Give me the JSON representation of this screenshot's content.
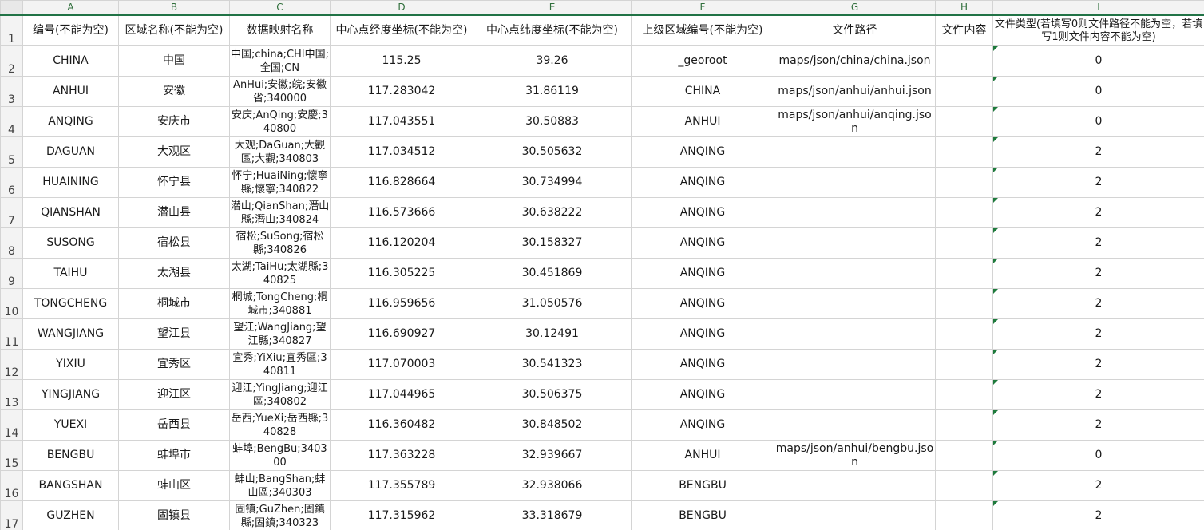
{
  "columns": [
    "A",
    "B",
    "C",
    "D",
    "E",
    "F",
    "G",
    "H",
    "I"
  ],
  "header_row": {
    "row_number": "1",
    "cells": [
      "编号(不能为空)",
      "区域名称(不能为空)",
      "数据映射名称",
      "中心点经度坐标(不能为空)",
      "中心点纬度坐标(不能为空)",
      "上级区域编号(不能为空)",
      "文件路径",
      "文件内容",
      "文件类型(若填写0则文件路径不能为空，若填写1则文件内容不能为空)"
    ]
  },
  "rows": [
    {
      "n": "2",
      "cells": [
        "CHINA",
        "中国",
        "中国;china;CHI中国;全国;CN",
        "115.25",
        "39.26",
        "_georoot",
        "maps/json/china/china.json",
        "",
        "0"
      ]
    },
    {
      "n": "3",
      "cells": [
        "ANHUI",
        "安徽",
        "AnHui;安徽;皖;安徽省;340000",
        "117.283042",
        "31.86119",
        "CHINA",
        "maps/json/anhui/anhui.json",
        "",
        "0"
      ]
    },
    {
      "n": "4",
      "cells": [
        "ANQING",
        "安庆市",
        "安庆;AnQing;安慶;340800",
        "117.043551",
        "30.50883",
        "ANHUI",
        "maps/json/anhui/anqing.json",
        "",
        "0"
      ]
    },
    {
      "n": "5",
      "cells": [
        "DAGUAN",
        "大观区",
        "大观;DaGuan;大觀區;大觀;340803",
        "117.034512",
        "30.505632",
        "ANQING",
        "",
        "",
        "2"
      ]
    },
    {
      "n": "6",
      "cells": [
        "HUAINING",
        "怀宁县",
        "怀宁;HuaiNing;懷寧縣;懷寧;340822",
        "116.828664",
        "30.734994",
        "ANQING",
        "",
        "",
        "2"
      ]
    },
    {
      "n": "7",
      "cells": [
        "QIANSHAN",
        "潜山县",
        "潜山;QianShan;潛山縣;潛山;340824",
        "116.573666",
        "30.638222",
        "ANQING",
        "",
        "",
        "2"
      ]
    },
    {
      "n": "8",
      "cells": [
        "SUSONG",
        "宿松县",
        "宿松;SuSong;宿松縣;340826",
        "116.120204",
        "30.158327",
        "ANQING",
        "",
        "",
        "2"
      ]
    },
    {
      "n": "9",
      "cells": [
        "TAIHU",
        "太湖县",
        "太湖;TaiHu;太湖縣;340825",
        "116.305225",
        "30.451869",
        "ANQING",
        "",
        "",
        "2"
      ]
    },
    {
      "n": "10",
      "cells": [
        "TONGCHENG",
        "桐城市",
        "桐城;TongCheng;桐城市;340881",
        "116.959656",
        "31.050576",
        "ANQING",
        "",
        "",
        "2"
      ]
    },
    {
      "n": "11",
      "cells": [
        "WANGJIANG",
        "望江县",
        "望江;WangJiang;望江縣;340827",
        "116.690927",
        "30.12491",
        "ANQING",
        "",
        "",
        "2"
      ]
    },
    {
      "n": "12",
      "cells": [
        "YIXIU",
        "宜秀区",
        "宜秀;YiXiu;宜秀區;340811",
        "117.070003",
        "30.541323",
        "ANQING",
        "",
        "",
        "2"
      ]
    },
    {
      "n": "13",
      "cells": [
        "YINGJIANG",
        "迎江区",
        "迎江;YingJiang;迎江區;340802",
        "117.044965",
        "30.506375",
        "ANQING",
        "",
        "",
        "2"
      ]
    },
    {
      "n": "14",
      "cells": [
        "YUEXI",
        "岳西县",
        "岳西;YueXi;岳西縣;340828",
        "116.360482",
        "30.848502",
        "ANQING",
        "",
        "",
        "2"
      ]
    },
    {
      "n": "15",
      "cells": [
        "BENGBU",
        "蚌埠市",
        "蚌埠;BengBu;340300",
        "117.363228",
        "32.939667",
        "ANHUI",
        "maps/json/anhui/bengbu.json",
        "",
        "0"
      ]
    },
    {
      "n": "16",
      "cells": [
        "BANGSHAN",
        "蚌山区",
        "蚌山;BangShan;蚌山區;340303",
        "117.355789",
        "32.938066",
        "BENGBU",
        "",
        "",
        "2"
      ]
    },
    {
      "n": "17",
      "cells": [
        "GUZHEN",
        "固镇县",
        "固镇;GuZhen;固鎮縣;固鎮;340323",
        "117.315962",
        "33.318679",
        "BENGBU",
        "",
        "",
        "2"
      ]
    }
  ]
}
